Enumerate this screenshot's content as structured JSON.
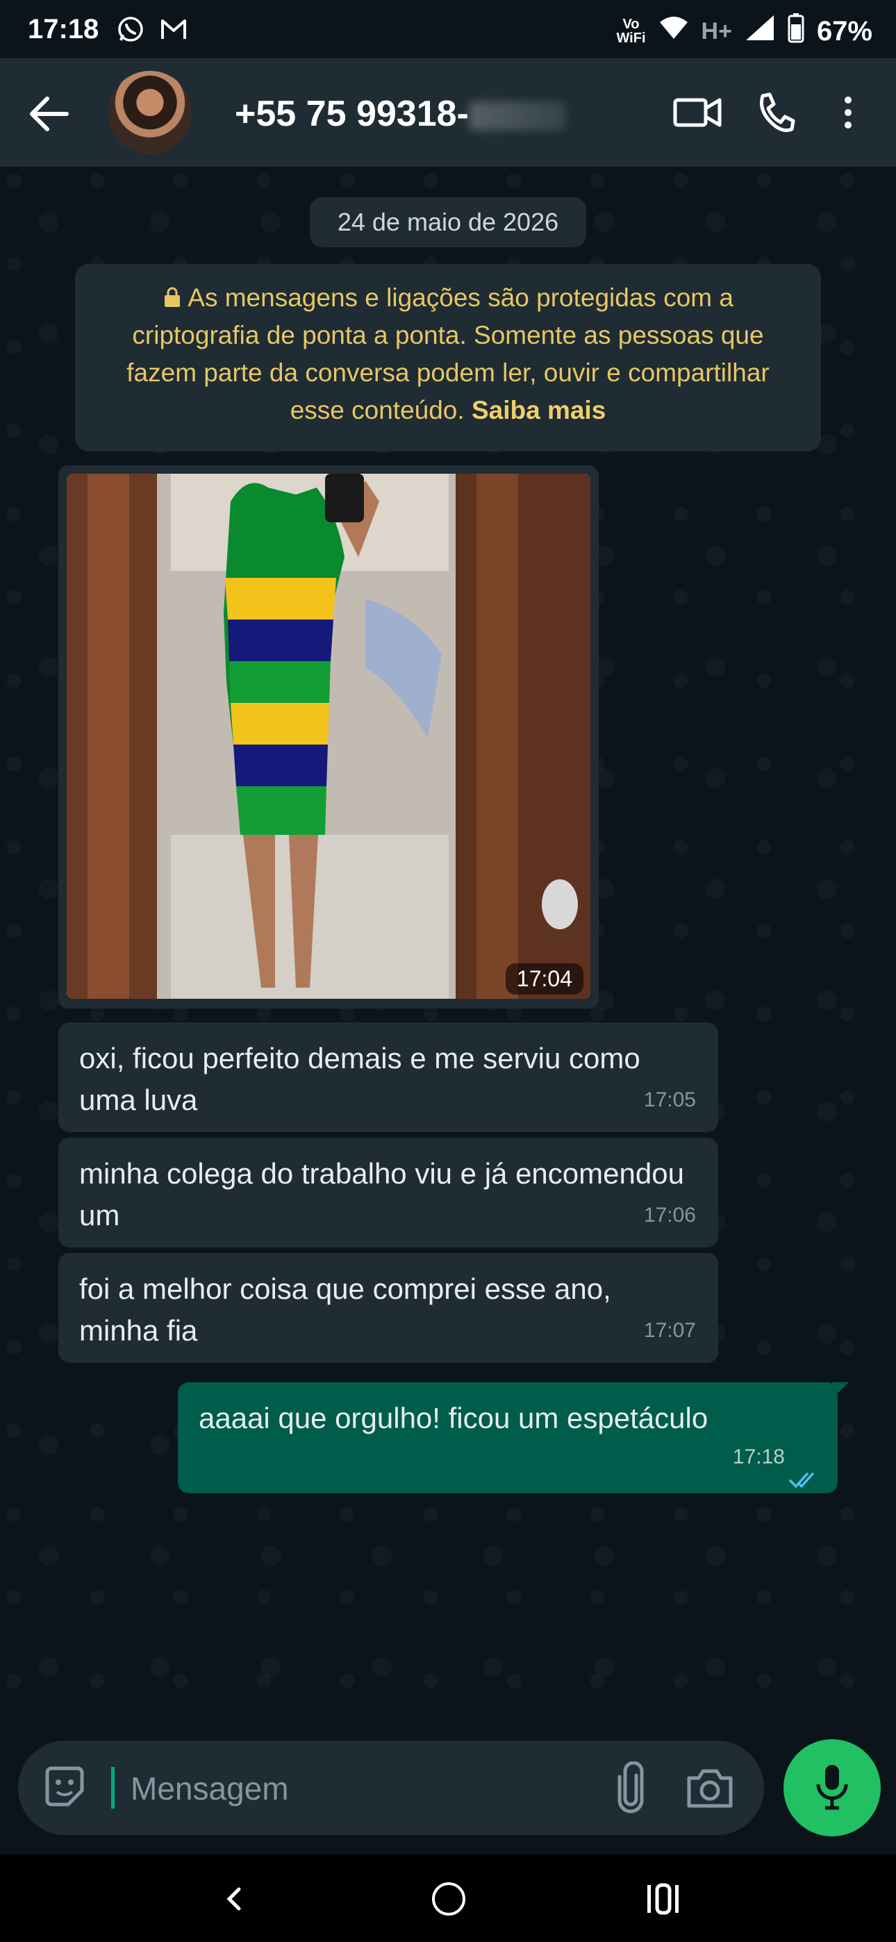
{
  "status_bar": {
    "time": "17:18",
    "left_icons": [
      "whatsapp-icon",
      "gmail-icon"
    ],
    "vowifi_top": "Vo",
    "vowifi_bottom": "WiFi",
    "network": "H+",
    "battery": "67%"
  },
  "header": {
    "contact_name": "+55 75 99318-",
    "icons": [
      "back-arrow-icon",
      "video-call-icon",
      "phone-call-icon",
      "more-options-icon"
    ]
  },
  "chat": {
    "date_chip": "24 de maio de 2026",
    "encryption_notice": "As mensagens e ligações são protegidas com a criptografia de ponta a ponta. Somente as pessoas que fazem parte da conversa podem ler, ouvir e compartilhar esse conteúdo.",
    "encryption_link": "Saiba mais",
    "image_message": {
      "time": "17:04"
    },
    "incoming": [
      {
        "text": "oxi, ficou perfeito demais e me serviu como uma luva",
        "time": "17:05"
      },
      {
        "text": "minha colega do trabalho viu e já encomendou um",
        "time": "17:06"
      },
      {
        "text": "foi a melhor coisa que comprei esse ano, minha fia",
        "time": "17:07"
      }
    ],
    "outgoing": {
      "text": "aaaai que orgulho! ficou um espetáculo",
      "time": "17:18",
      "status": "read"
    }
  },
  "composer": {
    "placeholder": "Mensagem",
    "icons": [
      "sticker-icon",
      "attach-icon",
      "camera-icon",
      "mic-icon"
    ]
  },
  "colors": {
    "background": "#0b141a",
    "header": "#202c33",
    "incoming_bubble": "#202c33",
    "outgoing_bubble": "#005c4b",
    "accent": "#21c063",
    "encryption_text": "#e7c764",
    "read_ticks": "#53bdeb"
  }
}
